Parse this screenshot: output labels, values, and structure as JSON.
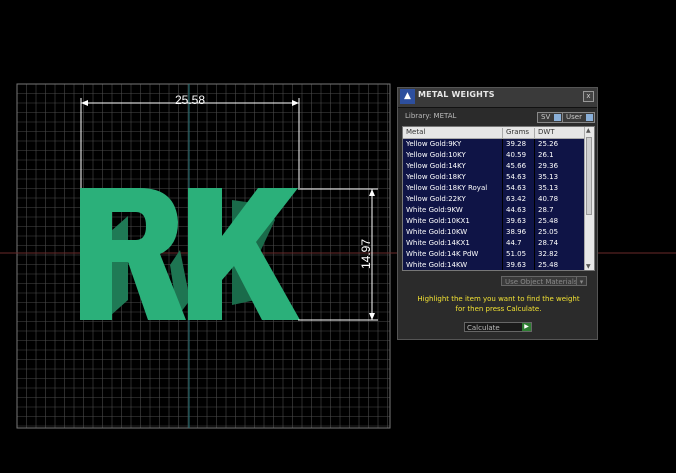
{
  "viewport": {
    "dimension_width": "25.58",
    "dimension_height": "14.97",
    "model_text": "RK",
    "model_color": "#2bb07a"
  },
  "panel": {
    "logo_glyph": "▲",
    "title": "METAL WEIGHTS",
    "close_label": "x",
    "library_label": "Library: METAL",
    "sv_label": "SV",
    "user_label": "User",
    "columns": [
      "Metal",
      "Grams",
      "DWT"
    ],
    "rows": [
      {
        "metal": "Yellow Gold:9KY",
        "grams": "39.28",
        "dwt": "25.26"
      },
      {
        "metal": "Yellow Gold:10KY",
        "grams": "40.59",
        "dwt": "26.1"
      },
      {
        "metal": "Yellow Gold:14KY",
        "grams": "45.66",
        "dwt": "29.36"
      },
      {
        "metal": "Yellow Gold:18KY",
        "grams": "54.63",
        "dwt": "35.13"
      },
      {
        "metal": "Yellow Gold:18KY Royal",
        "grams": "54.63",
        "dwt": "35.13"
      },
      {
        "metal": "Yellow Gold:22KY",
        "grams": "63.42",
        "dwt": "40.78"
      },
      {
        "metal": "White Gold:9KW",
        "grams": "44.63",
        "dwt": "28.7"
      },
      {
        "metal": "White Gold:10KX1",
        "grams": "39.63",
        "dwt": "25.48"
      },
      {
        "metal": "White Gold:10KW",
        "grams": "38.96",
        "dwt": "25.05"
      },
      {
        "metal": "White Gold:14KX1",
        "grams": "44.7",
        "dwt": "28.74"
      },
      {
        "metal": "White Gold:14K PdW",
        "grams": "51.05",
        "dwt": "32.82"
      },
      {
        "metal": "White Gold:14KW",
        "grams": "39.63",
        "dwt": "25.48"
      }
    ],
    "use_object_label": "Use Object Materials",
    "help_line1": "Highlight the item you want to find the weight",
    "help_line2": "for then press Calculate.",
    "calculate_label": "Calculate"
  }
}
